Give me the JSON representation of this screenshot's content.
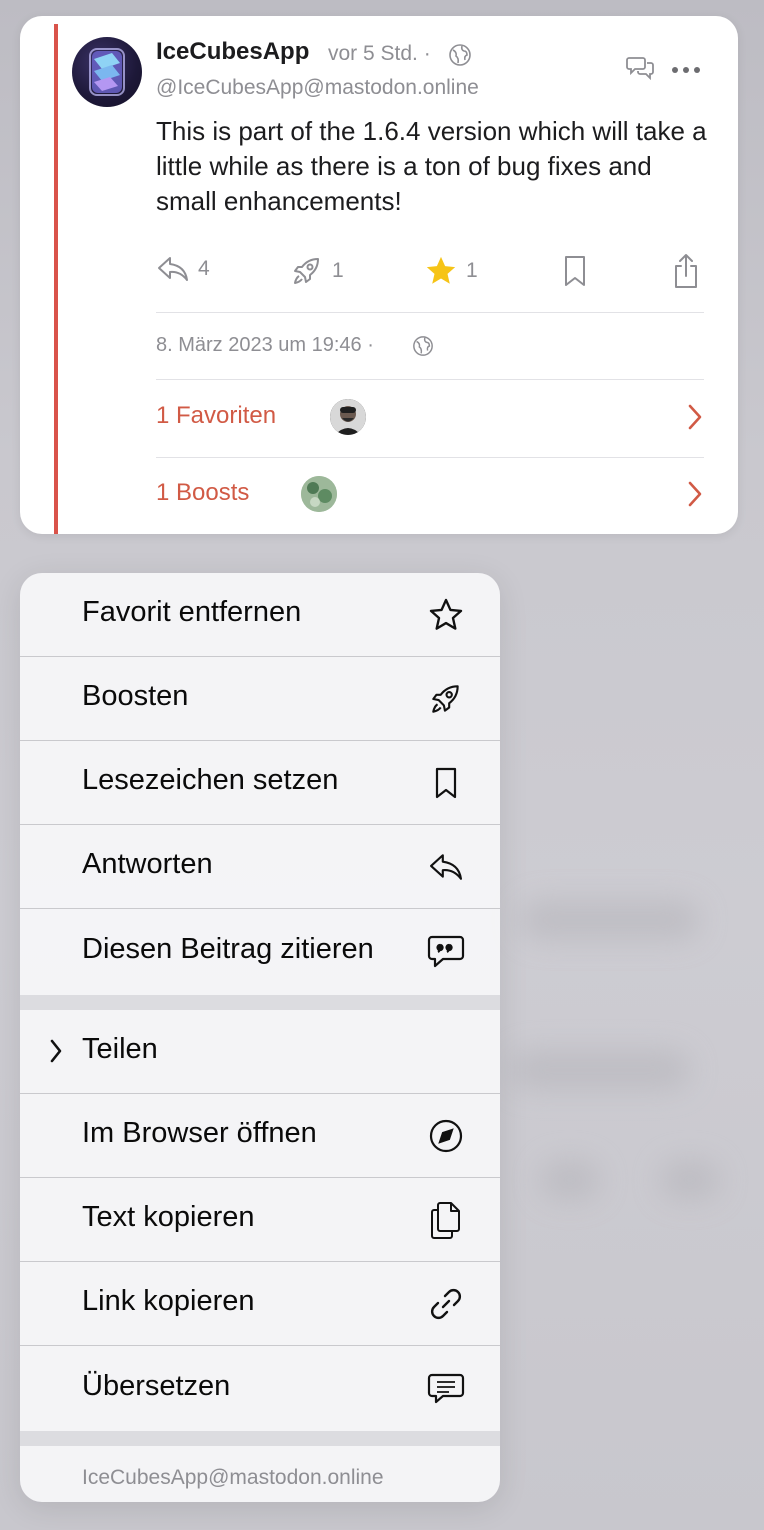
{
  "post": {
    "author": "IceCubesApp",
    "time": "vor 5 Std. ·",
    "handle": "@IceCubesApp@mastodon.online",
    "text": "This is part of the 1.6.4 version which will take a little while as there is a ton of bug fixes and small enhancements!",
    "actions": {
      "reply_count": "4",
      "boost_count": "1",
      "favorite_count": "1"
    },
    "date": "8. März 2023 um 19:46 ·",
    "favorites_label": "1 Favoriten",
    "boosts_label": "1 Boosts",
    "accent_color": "#d15a45",
    "icons": [
      "globe-icon",
      "conversation-icon",
      "more-icon",
      "reply-icon",
      "boost-icon",
      "star-icon",
      "bookmark-icon",
      "share-icon",
      "chevron-right-icon"
    ]
  },
  "menu": {
    "items": [
      {
        "label": "Favorit entfernen",
        "icon": "star-outline-icon"
      },
      {
        "label": "Boosten",
        "icon": "rocket-icon"
      },
      {
        "label": "Lesezeichen setzen",
        "icon": "bookmark-icon"
      },
      {
        "label": "Antworten",
        "icon": "reply-icon"
      },
      {
        "label": "Diesen Beitrag zitieren",
        "icon": "quote-bubble-icon"
      },
      {
        "label": "Teilen",
        "icon": "chevron-right-icon"
      },
      {
        "label": "Im Browser öffnen",
        "icon": "compass-icon"
      },
      {
        "label": "Text kopieren",
        "icon": "copy-icon"
      },
      {
        "label": "Link kopieren",
        "icon": "link-icon"
      },
      {
        "label": "Übersetzen",
        "icon": "translate-bubble-icon"
      }
    ],
    "footer": "IceCubesApp@mastodon.online"
  }
}
